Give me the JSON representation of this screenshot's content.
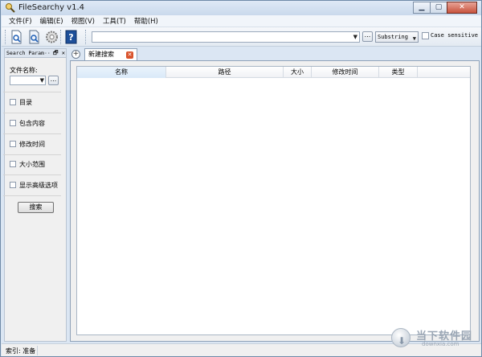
{
  "window": {
    "title": "FileSearchy v1.4",
    "controls": {
      "minimize": "▁",
      "maximize": "▢",
      "close": "✕"
    }
  },
  "menubar": {
    "items": [
      "文件(F)",
      "编辑(E)",
      "视图(V)",
      "工具(T)",
      "帮助(H)"
    ]
  },
  "toolbar": {
    "buttons": [
      "new-search-icon",
      "find-icon",
      "settings-icon",
      "help-icon"
    ],
    "search_value": "",
    "browse_label": "...",
    "match_mode": "Substring",
    "case_sensitive_label": "Case sensitive",
    "case_sensitive_checked": false
  },
  "left_panel": {
    "header": "Search Param···",
    "header_buttons": "🗗 ✕",
    "filename_label": "文件名称:",
    "filename_value": "",
    "browse_label": "...",
    "options": [
      {
        "label": "目录",
        "checked": false
      },
      {
        "label": "包含内容",
        "checked": false
      },
      {
        "label": "修改时间",
        "checked": false
      },
      {
        "label": "大小范围",
        "checked": false
      },
      {
        "label": "显示高级选项",
        "checked": false
      }
    ],
    "search_button": "搜索"
  },
  "tabs": {
    "add_label": "+",
    "items": [
      {
        "label": "新建搜索",
        "close": "✕"
      }
    ]
  },
  "results": {
    "columns": [
      "名称",
      "路径",
      "大小",
      "修改时间",
      "类型"
    ],
    "rows": []
  },
  "statusbar": {
    "text": "索引: 准备"
  },
  "watermark": {
    "text": "当下软件园",
    "url": "downxia.com"
  },
  "colors": {
    "frame": "#dbe6f3",
    "accent_close": "#c8523c",
    "tab_close": "#d9532c"
  }
}
